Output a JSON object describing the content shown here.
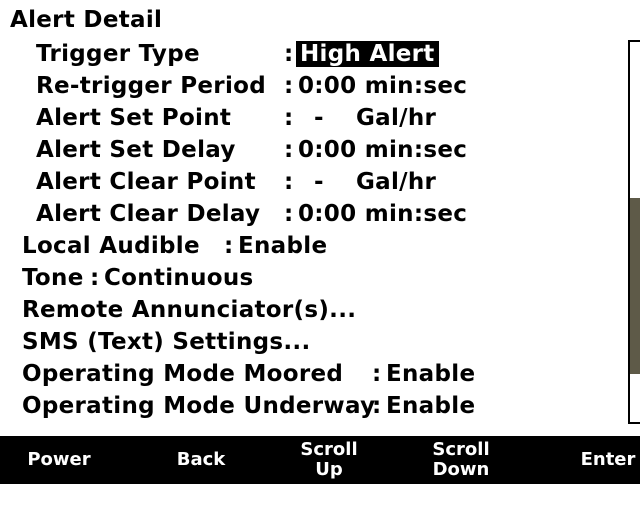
{
  "header": {
    "title": "Alert Detail"
  },
  "settings": [
    {
      "label": "Trigger Type",
      "value": "High Alert",
      "selected": true
    },
    {
      "label": "Re-trigger Period",
      "value": "0:00 min:sec"
    },
    {
      "label": "Alert Set Point",
      "value": "-",
      "unit": "Gal/hr"
    },
    {
      "label": "Alert Set Delay",
      "value": "0:00 min:sec"
    },
    {
      "label": "Alert Clear Point",
      "value": "-",
      "unit": "Gal/hr"
    },
    {
      "label": "Alert Clear Delay",
      "value": "0:00 min:sec"
    }
  ],
  "menu": [
    {
      "label": "Local Audible",
      "value": "Enable"
    },
    {
      "label": "Tone",
      "value": "Continuous"
    },
    {
      "label": "Remote Annunciator(s)..."
    },
    {
      "label": "SMS (Text) Settings..."
    },
    {
      "label": "Operating Mode Moored",
      "value": "Enable"
    },
    {
      "label": "Operating Mode Underway",
      "value": "Enable"
    }
  ],
  "softkeys": [
    {
      "line1": "Power"
    },
    {
      "line1": "Back"
    },
    {
      "line1": "Scroll",
      "line2": "Up"
    },
    {
      "line1": "Scroll",
      "line2": "Down"
    },
    {
      "line1": "Enter"
    }
  ],
  "colon": ":",
  "colors": {
    "background": "#ffffff",
    "text": "#000000",
    "highlight": "#000000",
    "scroll_thumb": "#5e5a48"
  }
}
